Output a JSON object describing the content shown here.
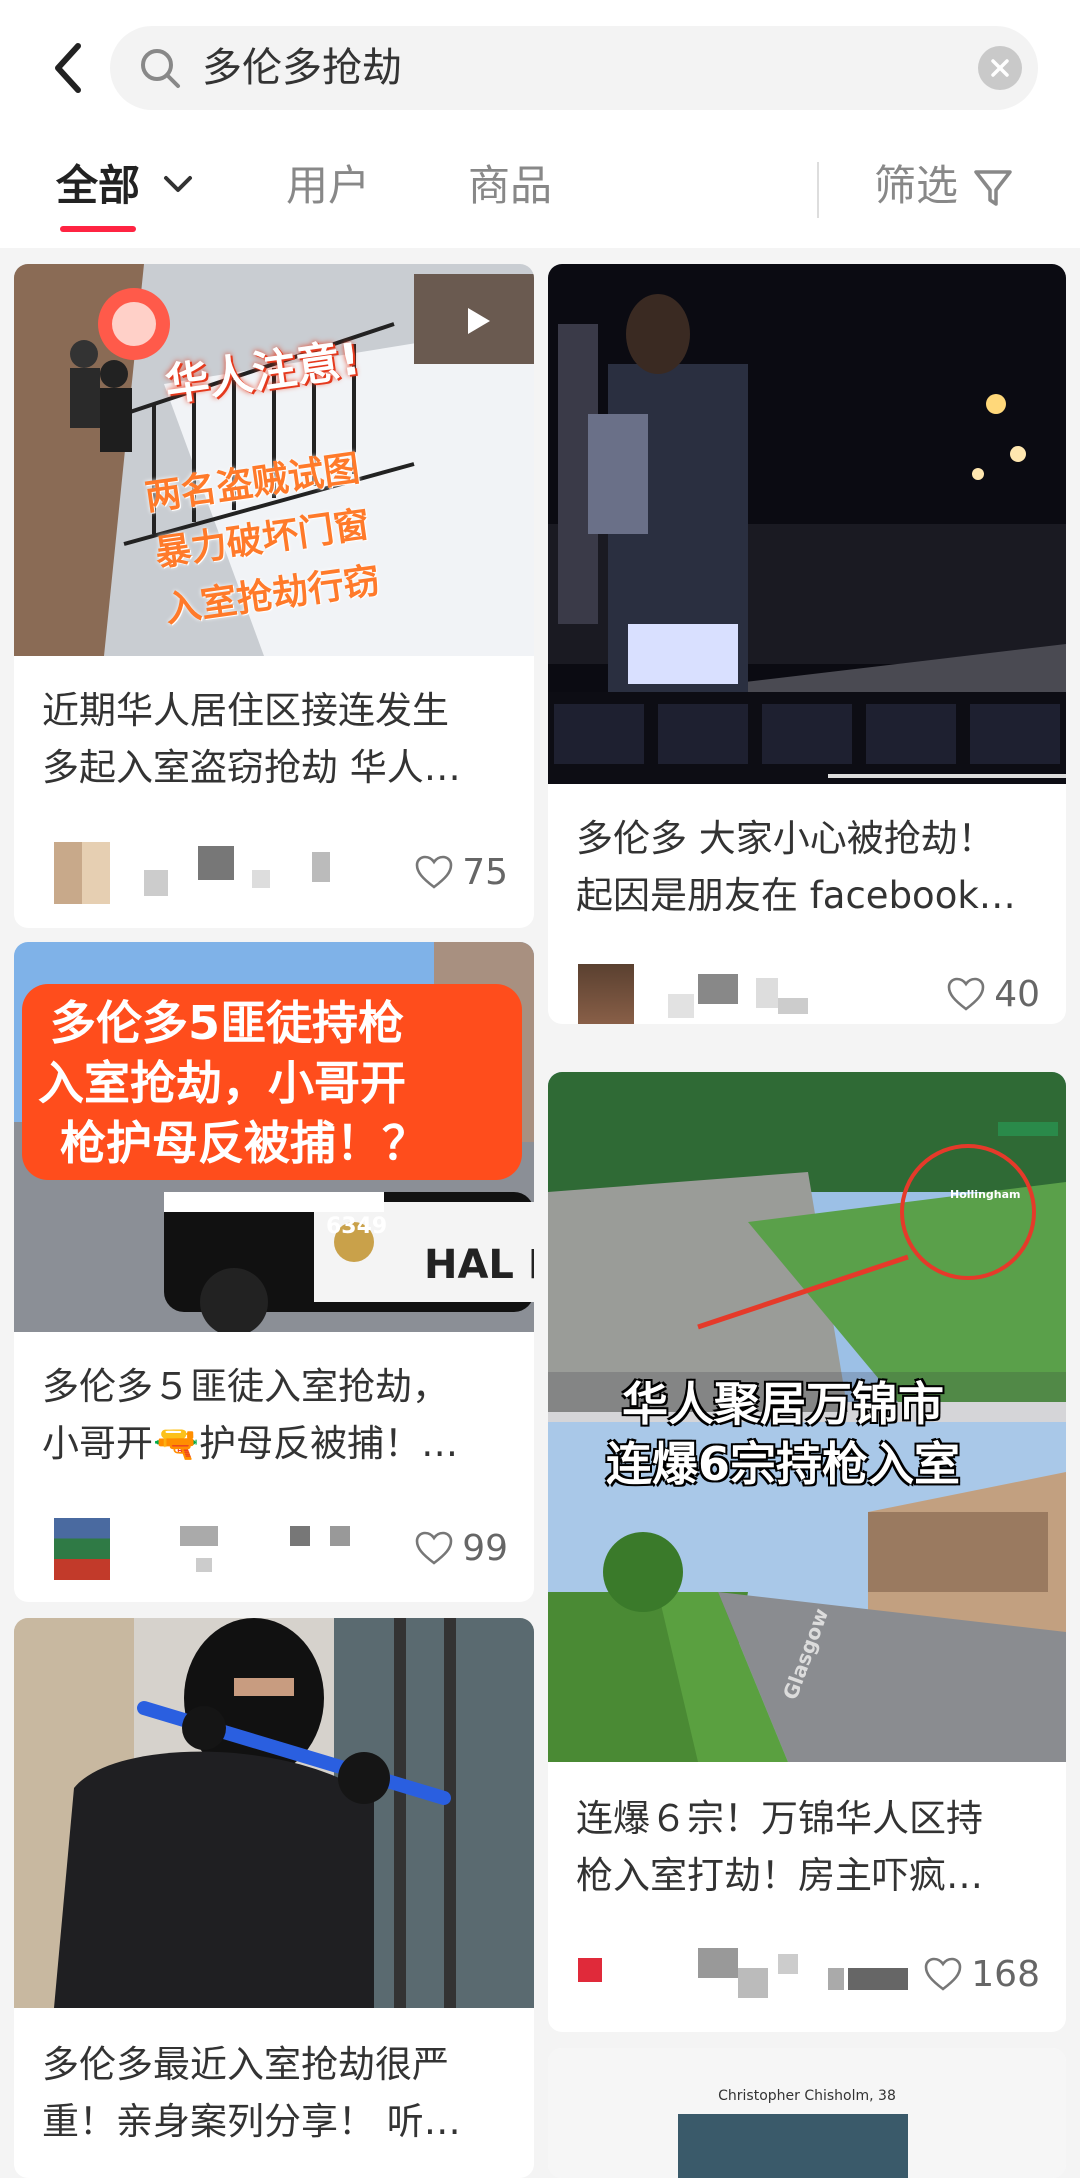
{
  "search": {
    "query": "多伦多抢劫"
  },
  "tabs": {
    "all": "全部",
    "users": "用户",
    "goods": "商品",
    "filter": "筛选"
  },
  "colors": {
    "accent": "#ff2442",
    "background": "#f4f4f4"
  },
  "cards": [
    {
      "overlay": [
        "华人注意!",
        "两名盗贼试图",
        "暴力破坏门窗",
        "入室抢劫行窃"
      ],
      "is_video": true,
      "title": "近期华人居住区接连发生\n多起入室盗窃抢劫 华人…",
      "likes": "75"
    },
    {
      "overlay": [],
      "title": "多伦多 大家小心被抢劫！\n起因是朋友在 facebook…",
      "likes": "40"
    },
    {
      "overlay": [
        "多伦多5匪徒持枪",
        "入室抢劫，小哥开",
        "枪护母反被捕！？"
      ],
      "sign_text": "HAL PO",
      "car_number": "6349",
      "title": "多伦多５匪徒入室抢劫，\n小哥开🔫护母反被捕！…",
      "likes": "99"
    },
    {
      "overlay": [
        "华人聚居万锦市",
        "连爆6宗持枪入室"
      ],
      "street_sign": "Hollingham",
      "road_text": "Glasgow",
      "title": "连爆６宗！万锦华人区持\n枪入室打劫！房主吓疯…",
      "likes": "168"
    },
    {
      "title": "多伦多最近入室抢劫很严\n重！亲身案列分享！ 听…"
    },
    {
      "caption": "Christopher Chisholm, 38"
    }
  ],
  "icons": {
    "back": "chevron-left-icon",
    "search": "search-icon",
    "clear": "close-icon",
    "dropdown": "chevron-down-icon",
    "filter": "funnel-icon",
    "like": "heart-outline-icon",
    "play": "play-icon"
  }
}
